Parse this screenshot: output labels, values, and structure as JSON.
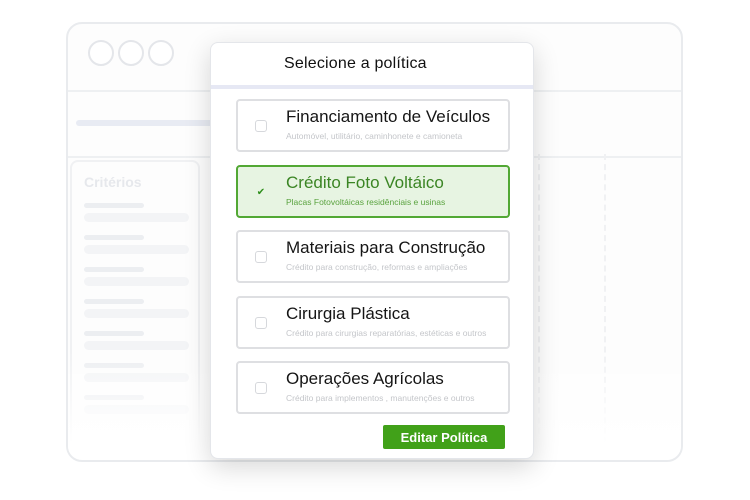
{
  "background": {
    "sidebar_title": "Critérios"
  },
  "modal": {
    "title": "Selecione a política",
    "options": [
      {
        "title": "Financiamento de Veículos",
        "subtitle": "Automóvel, utilitário, caminhonete e camioneta",
        "selected": false
      },
      {
        "title": "Crédito Foto Voltáico",
        "subtitle": "Placas Fotovoltáicas residênciais e usinas",
        "selected": true
      },
      {
        "title": "Materiais para Construção",
        "subtitle": "Crédito para construção, reformas e ampliações",
        "selected": false
      },
      {
        "title": "Cirurgia Plástica",
        "subtitle": "Crédito para cirurgias reparatórias, estéticas e outros",
        "selected": false
      },
      {
        "title": "Operações Agrícolas",
        "subtitle": "Crédito para implementos , manutenções e outros",
        "selected": false
      }
    ],
    "checkmark_glyph": "✔",
    "edit_button_label": "Editar Política"
  },
  "colors": {
    "accent_green": "#41a119",
    "selected_bg": "#e7f4e2",
    "selected_border": "#52a834"
  }
}
